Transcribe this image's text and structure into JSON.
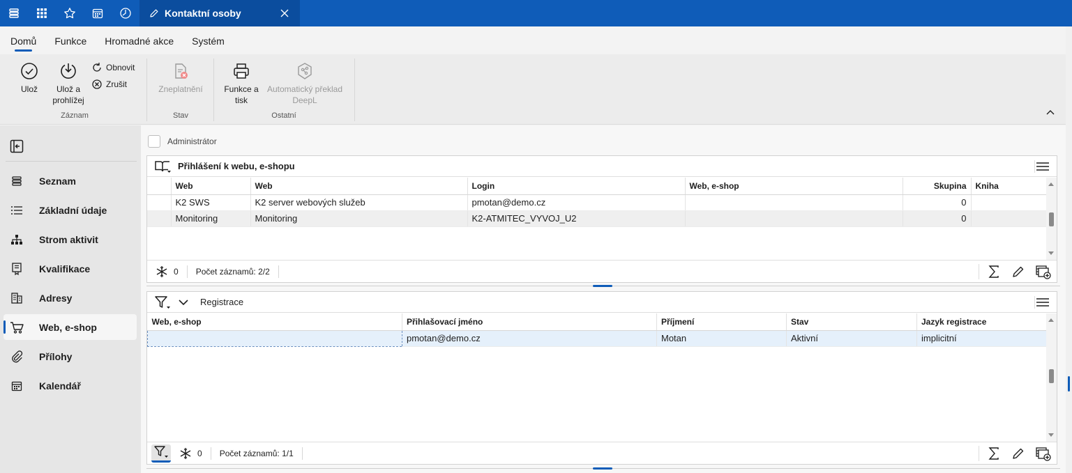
{
  "titlebar": {
    "tab_title": "Kontaktní osoby",
    "icons": [
      "menu-icon",
      "apps-grid-icon",
      "star-icon",
      "calendar-icon",
      "history-clock-icon"
    ]
  },
  "ribbon": {
    "tabs": [
      "Domů",
      "Funkce",
      "Hromadné akce",
      "Systém"
    ],
    "active_tab": "Domů",
    "save": "Ulož",
    "save_view_1": "Ulož a",
    "save_view_2": "prohlížej",
    "refresh": "Obnovit",
    "cancel": "Zrušit",
    "group_record": "Záznam",
    "invalidate": "Zneplatnění",
    "group_state": "Stav",
    "print_1": "Funkce a",
    "print_2": "tisk",
    "deepl_1": "Automatický překlad",
    "deepl_2": "DeepL",
    "group_other": "Ostatní"
  },
  "sidebar": {
    "items": [
      {
        "label": "Seznam",
        "icon": "list-stack-icon"
      },
      {
        "label": "Základní údaje",
        "icon": "lines-icon"
      },
      {
        "label": "Strom aktivit",
        "icon": "tree-icon"
      },
      {
        "label": "Kvalifikace",
        "icon": "certificate-icon"
      },
      {
        "label": "Adresy",
        "icon": "building-icon"
      },
      {
        "label": "Web, e-shop",
        "icon": "cart-icon"
      },
      {
        "label": "Přílohy",
        "icon": "paperclip-icon"
      },
      {
        "label": "Kalendář",
        "icon": "calendar-icon"
      }
    ],
    "active": "Web, e-shop"
  },
  "main": {
    "admin_label": "Administrátor",
    "panel1": {
      "title": "Přihlášení k webu, e-shopu",
      "columns": [
        "Web",
        "Web",
        "Login",
        "Web, e-shop",
        "Skupina",
        "Kniha"
      ],
      "rows": [
        [
          "K2 SWS",
          "K2 server webových služeb",
          "pmotan@demo.cz",
          "",
          "0",
          ""
        ],
        [
          "Monitoring",
          "Monitoring",
          "K2-ATMITEC_VYVOJ_U2",
          "",
          "0",
          ""
        ]
      ],
      "filter_count": "0",
      "records": "Počet záznamů: 2/2"
    },
    "panel2": {
      "title": "Registrace",
      "columns": [
        "Web, e-shop",
        "Přihlašovací jméno",
        "Příjmení",
        "Stav",
        "Jazyk registrace"
      ],
      "rows": [
        [
          "",
          "pmotan@demo.cz",
          "Motan",
          "Aktivní",
          "implicitní"
        ]
      ],
      "filter_count": "0",
      "records": "Počet záznamů: 1/1"
    }
  },
  "colors": {
    "accent": "#0f5cb8",
    "titlebar": "#0f5cb8",
    "active_tab": "#0b4d9e"
  }
}
